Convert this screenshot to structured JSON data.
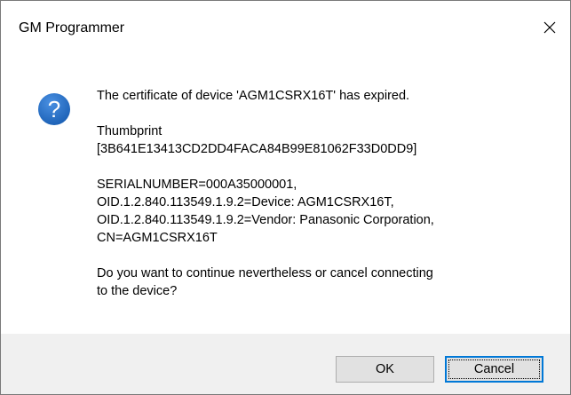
{
  "window": {
    "title": "GM Programmer"
  },
  "icons": {
    "close": "close-icon",
    "question": "question-icon",
    "question_color": "#1f68c4"
  },
  "message": {
    "line1": "The certificate of device 'AGM1CSRX16T' has expired.",
    "thumbprint_label": "Thumbprint",
    "thumbprint_value": "[3B641E13413CD2DD4FACA84B99E81062F33D0DD9]",
    "subject_line1": "SERIALNUMBER=000A35000001,",
    "subject_line2": "OID.1.2.840.113549.1.9.2=Device: AGM1CSRX16T,",
    "subject_line3": "OID.1.2.840.113549.1.9.2=Vendor: Panasonic Corporation,",
    "subject_line4": "CN=AGM1CSRX16T",
    "question_line1": "Do you want to continue nevertheless or cancel connecting",
    "question_line2": "to the device?"
  },
  "buttons": {
    "ok_label": "OK",
    "cancel_label": "Cancel"
  },
  "colors": {
    "accent": "#0078d7",
    "footer_bg": "#f0f0f0",
    "button_bg": "#e1e1e1"
  }
}
